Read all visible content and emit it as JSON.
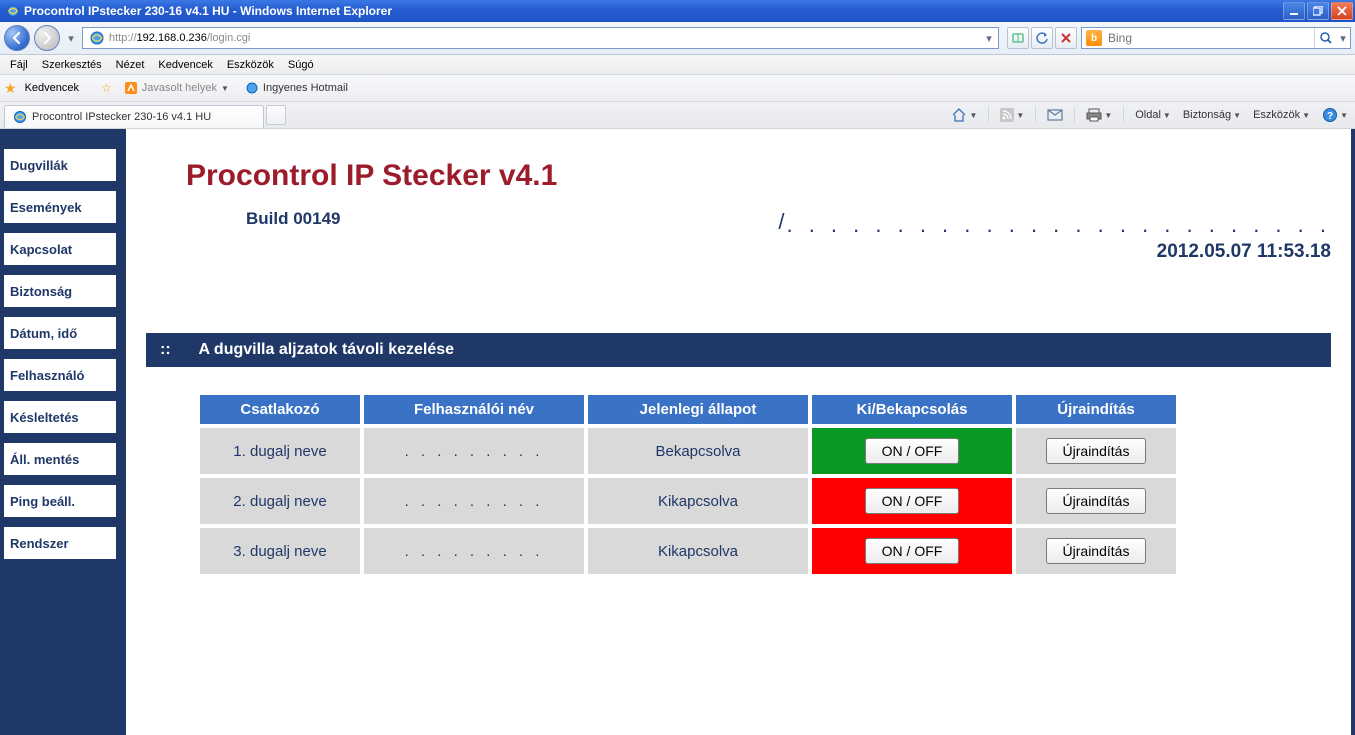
{
  "window": {
    "title": "Procontrol IPstecker 230-16 v4.1 HU - Windows Internet Explorer"
  },
  "address": {
    "url_prefix": "http://",
    "url_host": "192.168.0.236",
    "url_path": "/login.cgi"
  },
  "search": {
    "placeholder": "Bing"
  },
  "menus": {
    "items": [
      "Fájl",
      "Szerkesztés",
      "Nézet",
      "Kedvencek",
      "Eszközök",
      "Súgó"
    ]
  },
  "favbar": {
    "label": "Kedvencek",
    "suggested": "Javasolt helyek",
    "hotmail": "Ingyenes Hotmail"
  },
  "tab": {
    "title": "Procontrol IPstecker 230-16 v4.1 HU"
  },
  "cmd": {
    "page": "Oldal",
    "security": "Biztonság",
    "tools": "Eszközök"
  },
  "sidebar": {
    "items": [
      "Dugvillák",
      "Események",
      "Kapcsolat",
      "Biztonság",
      "Dátum, idő",
      "Felhasználó",
      "Késleltetés",
      "Áll. mentés",
      "Ping beáll.",
      "Rendszer"
    ]
  },
  "app": {
    "title": "Procontrol IP Stecker v4.1",
    "build": "Build 00149",
    "datetime": "2012.05.07 11:53.18",
    "section_prefix": "::",
    "section_title": "A dugvilla aljzatok távoli kezelése"
  },
  "table": {
    "headers": [
      "Csatlakozó",
      "Felhasználói név",
      "Jelenlegi állapot",
      "Ki/Bekapcsolás",
      "Újraindítás"
    ],
    "onoff_label": "ON / OFF",
    "restart_label": "Újraindítás",
    "dots": ". . . . . . . . .",
    "rows": [
      {
        "name": "1. dugalj neve",
        "status": "Bekapcsolva",
        "on": true
      },
      {
        "name": "2. dugalj neve",
        "status": "Kikapcsolva",
        "on": false
      },
      {
        "name": "3. dugalj neve",
        "status": "Kikapcsolva",
        "on": false
      }
    ]
  }
}
